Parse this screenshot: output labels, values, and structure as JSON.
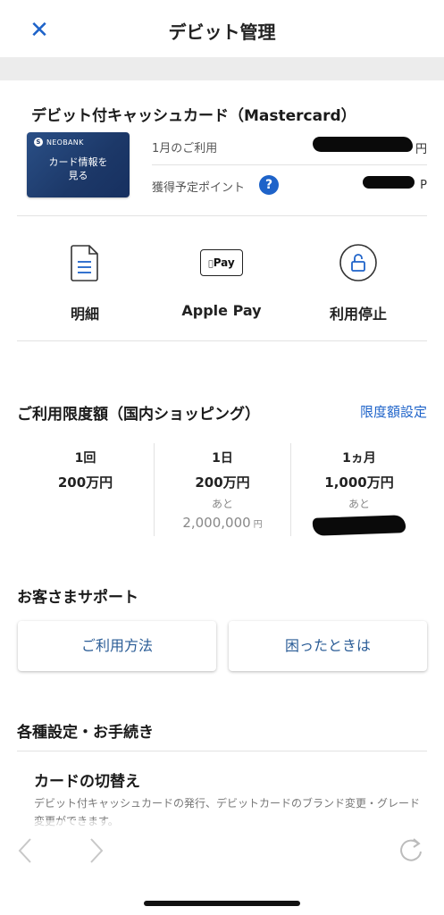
{
  "header": {
    "title": "デビット管理",
    "close_icon": "close-icon"
  },
  "card": {
    "title": "デビット付キャッシュカード（Mastercard）",
    "brand": "NEOBANK",
    "view_label": "カード情報を\n見る",
    "usage_label": "1月のご利用",
    "usage_unit": "円",
    "points_label": "獲得予定ポイント",
    "points_unit": "P",
    "help_mark": "?"
  },
  "actions": [
    {
      "label": "明細",
      "icon": "statement-document-icon"
    },
    {
      "label": "Apple Pay",
      "icon": "apple-pay-icon",
      "icon_text": "Pay"
    },
    {
      "label": "利用停止",
      "icon": "lock-icon"
    }
  ],
  "limits": {
    "title": "ご利用限度額（国内ショッピング）",
    "settings_link": "限度額設定",
    "columns": [
      {
        "period": "1回",
        "amount": "200万円"
      },
      {
        "period": "1日",
        "amount": "200万円",
        "remaining_label": "あと",
        "remaining": "2,000,000",
        "remaining_unit": "円"
      },
      {
        "period": "1ヵ月",
        "amount": "1,000万円",
        "remaining_label": "あと"
      }
    ]
  },
  "support": {
    "title": "お客さまサポート",
    "buttons": [
      "ご利用方法",
      "困ったときは"
    ]
  },
  "settings": {
    "title": "各種設定・お手続き",
    "items": [
      {
        "title": "カードの切替え",
        "description": "デビット付キャッシュカードの発行、デビットカードのブランド変更・グレード変更ができます。"
      }
    ]
  },
  "colors": {
    "accent": "#1e63c9",
    "card_bg": "#1c3868",
    "link": "#1e63c9",
    "support_text": "#2a5c96"
  }
}
